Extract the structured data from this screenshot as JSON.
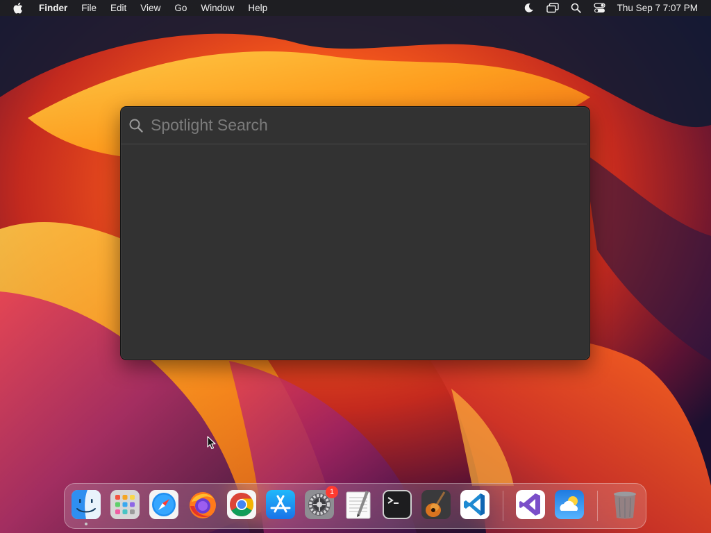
{
  "menubar": {
    "app_name": "Finder",
    "menus": [
      "File",
      "Edit",
      "View",
      "Go",
      "Window",
      "Help"
    ],
    "clock": "Thu Sep 7  7:07 PM",
    "status_icons": [
      "moon-icon",
      "screen-mirroring-icon",
      "search-icon",
      "control-center-icon"
    ]
  },
  "spotlight": {
    "placeholder": "Spotlight Search",
    "value": ""
  },
  "dock": {
    "items": [
      {
        "name": "Finder",
        "icon": "finder-icon",
        "running": true
      },
      {
        "name": "Launchpad",
        "icon": "launchpad-icon"
      },
      {
        "name": "Safari",
        "icon": "safari-icon"
      },
      {
        "name": "Firefox",
        "icon": "firefox-icon"
      },
      {
        "name": "Google Chrome",
        "icon": "chrome-icon"
      },
      {
        "name": "App Store",
        "icon": "app-store-icon"
      },
      {
        "name": "System Settings",
        "icon": "settings-icon",
        "badge": "1"
      },
      {
        "name": "TextEdit",
        "icon": "textedit-icon"
      },
      {
        "name": "Terminal",
        "icon": "terminal-icon"
      },
      {
        "name": "GarageBand",
        "icon": "garageband-icon"
      },
      {
        "name": "Visual Studio Code",
        "icon": "vscode-icon"
      },
      {
        "name": "Visual Studio",
        "icon": "visual-studio-icon"
      },
      {
        "name": "Weather",
        "icon": "weather-icon"
      },
      {
        "name": "Trash",
        "icon": "trash-icon"
      }
    ]
  },
  "colors": {
    "menubar_bg": "#1e1e22",
    "spotlight_bg": "#323232",
    "badge": "#ff3b30"
  }
}
